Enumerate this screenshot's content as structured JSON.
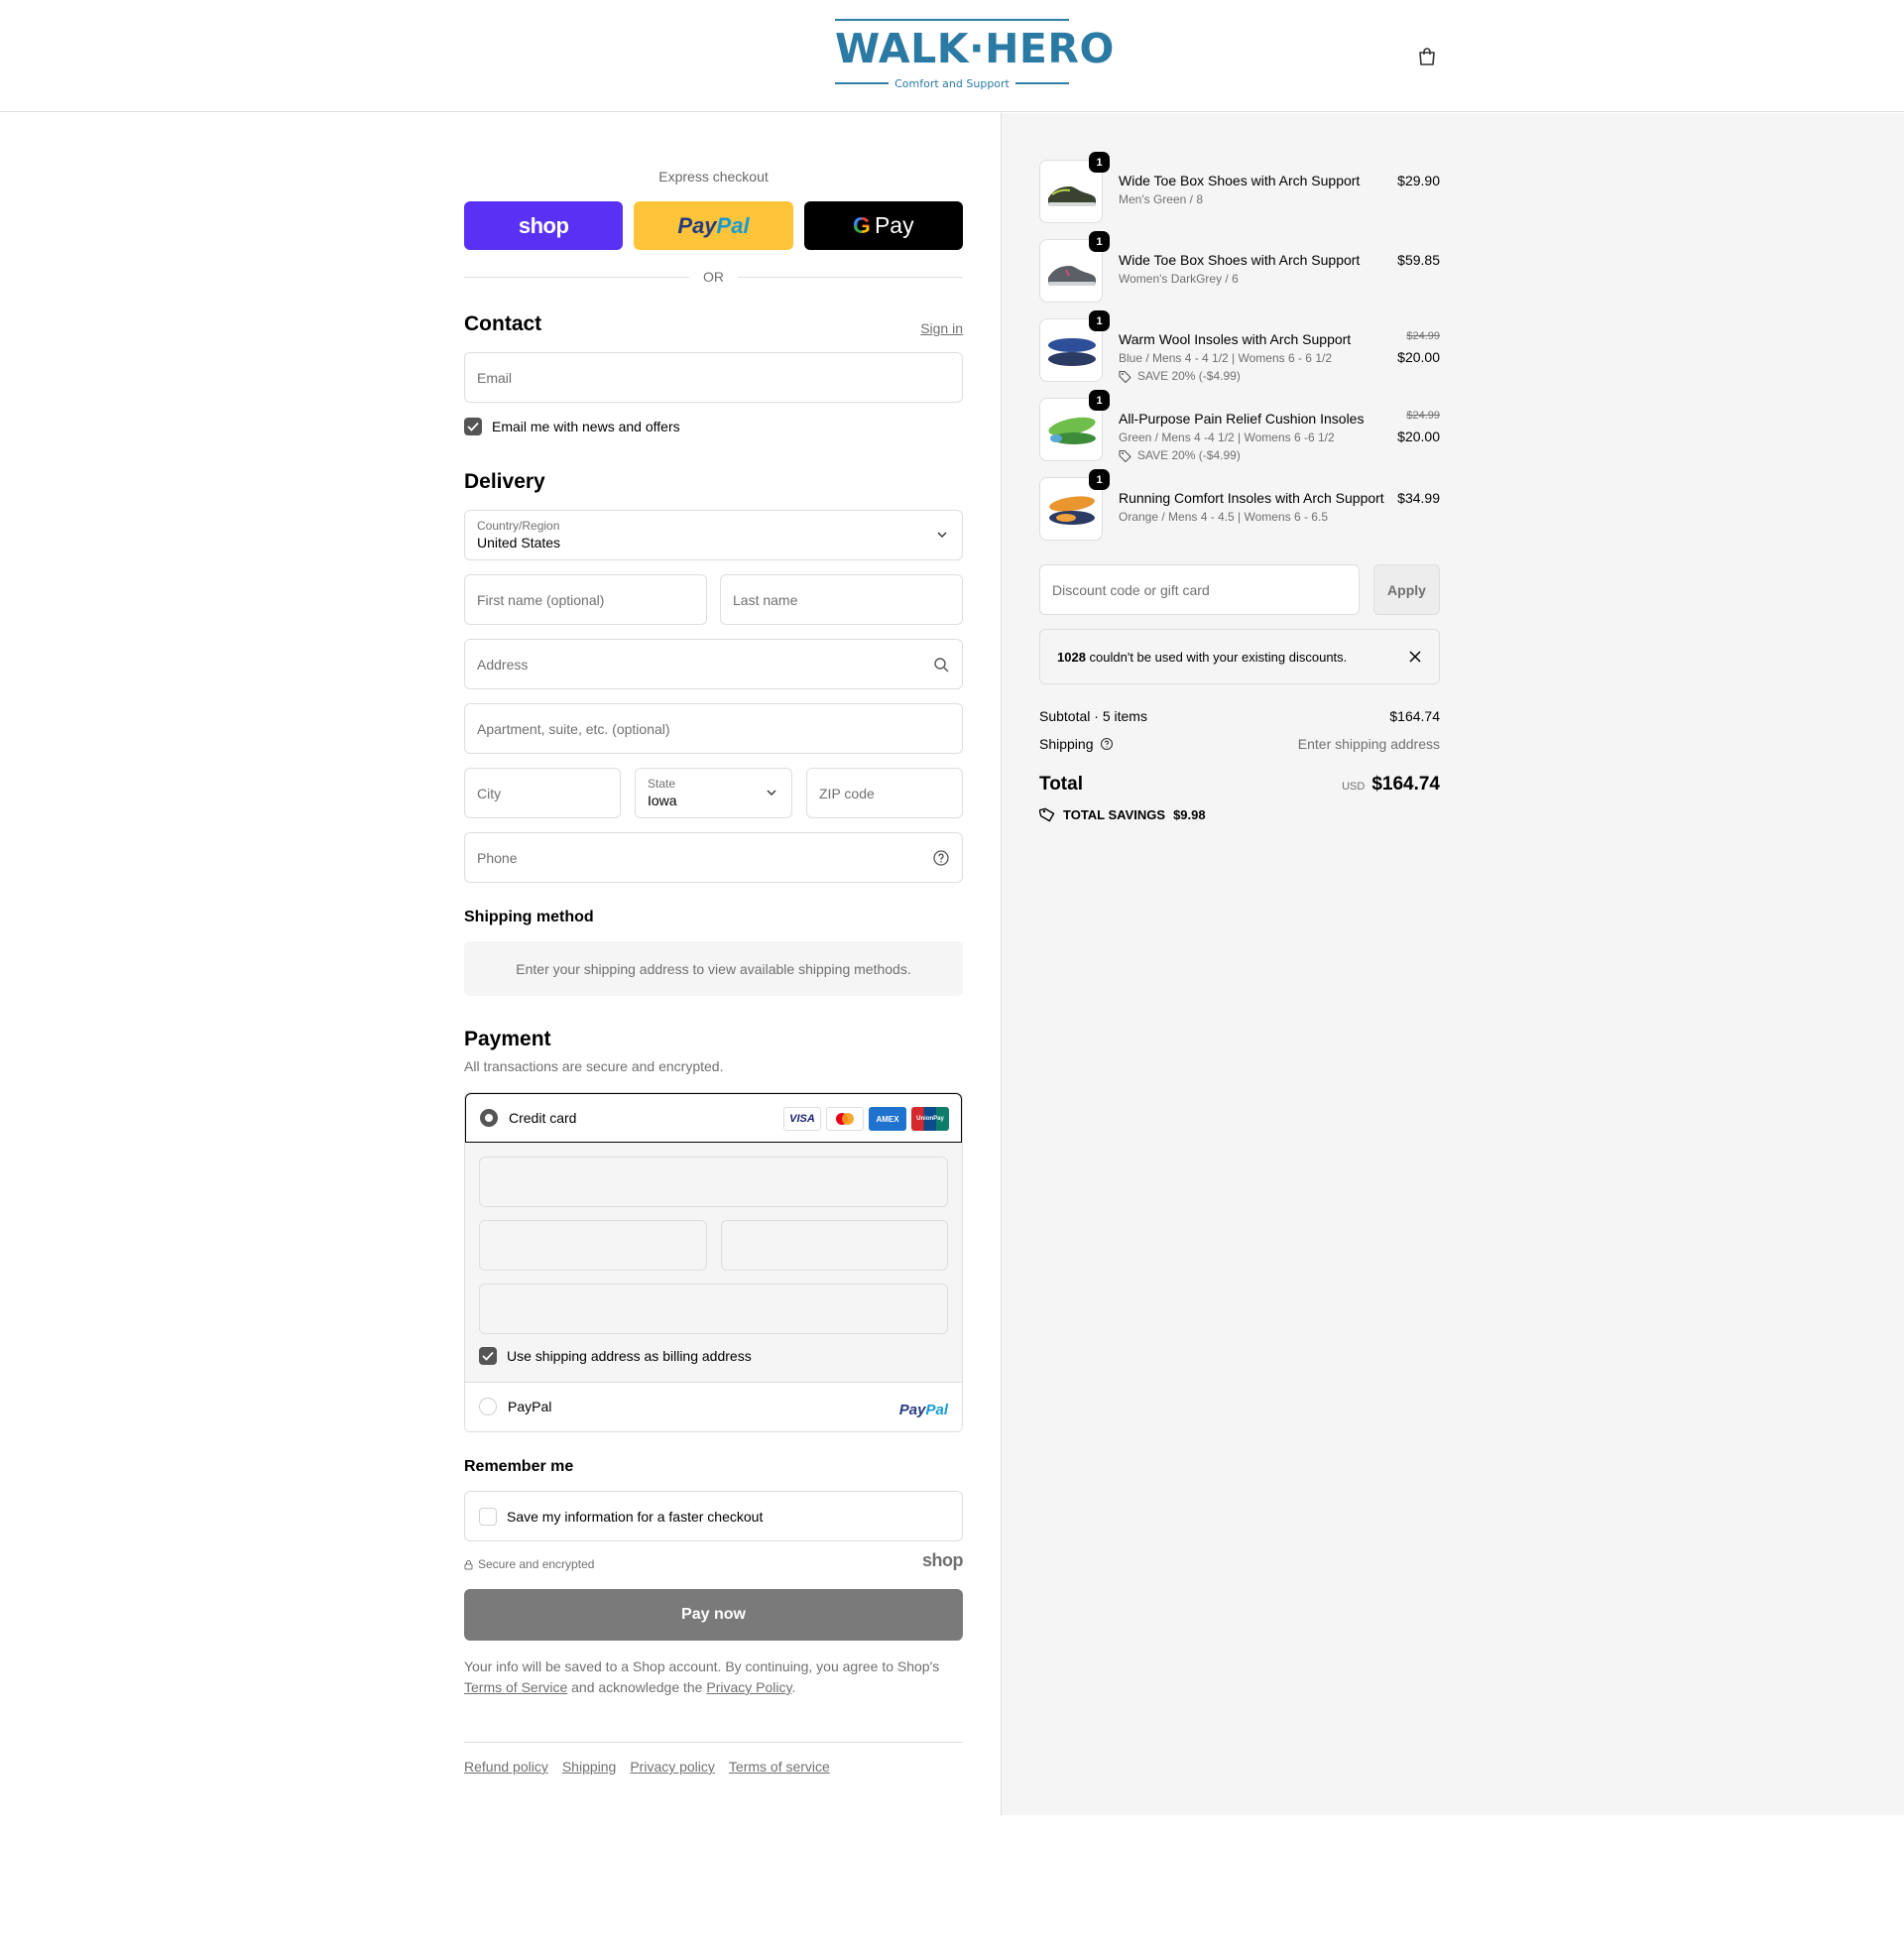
{
  "brand": {
    "name_left": "WALK",
    "separator": "·",
    "name_right": "HERO",
    "tagline": "Comfort and Support",
    "color": "#2a7aa3"
  },
  "header": {
    "cart_icon": "shopping-bag-icon"
  },
  "express": {
    "label": "Express checkout",
    "shop_label": "shop",
    "paypal_label_1": "Pay",
    "paypal_label_2": "Pal",
    "gpay_label": "Pay",
    "or_label": "OR"
  },
  "contact": {
    "title": "Contact",
    "sign_in": "Sign in",
    "email_placeholder": "Email",
    "news_label": "Email me with news and offers",
    "news_checked": true
  },
  "delivery": {
    "title": "Delivery",
    "country_label": "Country/Region",
    "country_value": "United States",
    "first_name_placeholder": "First name (optional)",
    "last_name_placeholder": "Last name",
    "address_placeholder": "Address",
    "apartment_placeholder": "Apartment, suite, etc. (optional)",
    "city_placeholder": "City",
    "state_label": "State",
    "state_value": "Iowa",
    "zip_placeholder": "ZIP code",
    "phone_placeholder": "Phone"
  },
  "shipping_method": {
    "title": "Shipping method",
    "message": "Enter your shipping address to view available shipping methods."
  },
  "payment": {
    "title": "Payment",
    "description": "All transactions are secure and encrypted.",
    "credit_card_label": "Credit card",
    "card_brands": [
      "VISA",
      "Mastercard",
      "AMEX",
      "UnionPay"
    ],
    "billing_label": "Use shipping address as billing address",
    "billing_checked": true,
    "paypal_label": "PayPal",
    "paypal_logo_1": "Pay",
    "paypal_logo_2": "Pal"
  },
  "remember": {
    "title": "Remember me",
    "save_label": "Save my information for a faster checkout",
    "secure_label": "Secure and encrypted",
    "shop_mark": "shop"
  },
  "pay_now_label": "Pay now",
  "legal": {
    "text_1": "Your info will be saved to a Shop account. By continuing, you agree to Shop's ",
    "terms_link": "Terms of Service",
    "text_2": " and acknowledge the ",
    "privacy_link": "Privacy Policy",
    "text_3": "."
  },
  "footer_links": [
    "Refund policy",
    "Shipping",
    "Privacy policy",
    "Terms of service"
  ],
  "order": {
    "items": [
      {
        "qty": "1",
        "name": "Wide Toe Box Shoes with Arch Support",
        "variant": "Men's Green / 8",
        "price": "$29.90"
      },
      {
        "qty": "1",
        "name": "Wide Toe Box Shoes with Arch Support",
        "variant": "Women's DarkGrey / 6",
        "price": "$59.85"
      },
      {
        "qty": "1",
        "name": "Warm Wool Insoles with Arch Support",
        "variant": "Blue / Mens 4 - 4 1/2 | Womens 6 - 6 1/2",
        "old_price": "$24.99",
        "price": "$20.00",
        "discount": "SAVE 20% (-$4.99)"
      },
      {
        "qty": "1",
        "name": "All-Purpose Pain Relief Cushion Insoles",
        "variant": "Green / Mens 4 -4 1/2 | Womens 6 -6 1/2",
        "old_price": "$24.99",
        "price": "$20.00",
        "discount": "SAVE 20% (-$4.99)"
      },
      {
        "qty": "1",
        "name": "Running Comfort Insoles with Arch Support",
        "variant": "Orange / Mens 4 - 4.5 | Womens 6 - 6.5",
        "price": "$34.99"
      }
    ],
    "discount_placeholder": "Discount code or gift card",
    "apply_label": "Apply",
    "alert_code": "1028",
    "alert_text": " couldn't be used with your existing discounts.",
    "subtotal_label": "Subtotal · 5 items",
    "subtotal_value": "$164.74",
    "shipping_label": "Shipping",
    "shipping_value": "Enter shipping address",
    "total_label": "Total",
    "currency": "USD",
    "total_value": "$164.74",
    "savings_label": "TOTAL SAVINGS",
    "savings_value": "$9.98"
  }
}
